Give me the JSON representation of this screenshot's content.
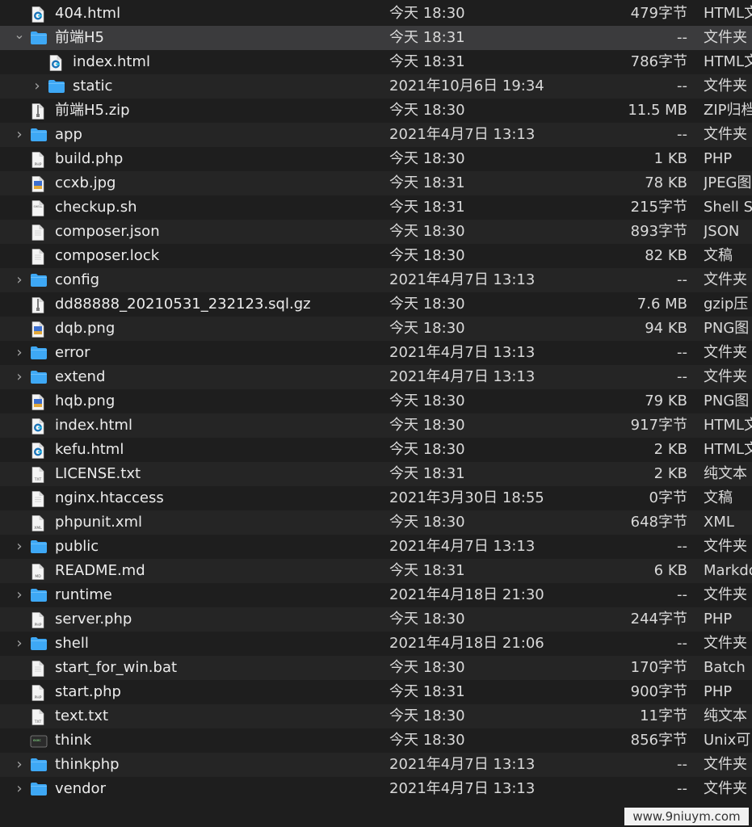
{
  "files": [
    {
      "name": "404.html",
      "date": "今天 18:30",
      "size": "479字节",
      "kind": "HTML文",
      "icon": "html-file-icon",
      "level": 0,
      "folder": false
    },
    {
      "name": "前端H5",
      "date": "今天 18:31",
      "size": "--",
      "kind": "文件夹",
      "icon": "folder-icon",
      "level": 0,
      "folder": true,
      "expanded": true,
      "selected": true
    },
    {
      "name": "index.html",
      "date": "今天 18:31",
      "size": "786字节",
      "kind": "HTML文",
      "icon": "html-file-icon",
      "level": 1,
      "folder": false
    },
    {
      "name": "static",
      "date": "2021年10月6日 19:34",
      "size": "--",
      "kind": "文件夹",
      "icon": "folder-icon",
      "level": 1,
      "folder": true
    },
    {
      "name": "前端H5.zip",
      "date": "今天 18:30",
      "size": "11.5 MB",
      "kind": "ZIP归档",
      "icon": "zip-file-icon",
      "level": 0,
      "folder": false
    },
    {
      "name": "app",
      "date": "2021年4月7日 13:13",
      "size": "--",
      "kind": "文件夹",
      "icon": "folder-icon",
      "level": 0,
      "folder": true
    },
    {
      "name": "build.php",
      "date": "今天 18:30",
      "size": "1 KB",
      "kind": "PHP",
      "icon": "php-file-icon",
      "level": 0,
      "folder": false
    },
    {
      "name": "ccxb.jpg",
      "date": "今天 18:31",
      "size": "78 KB",
      "kind": "JPEG图",
      "icon": "image-file-icon",
      "level": 0,
      "folder": false
    },
    {
      "name": "checkup.sh",
      "date": "今天 18:31",
      "size": "215字节",
      "kind": "Shell S",
      "icon": "shell-file-icon",
      "level": 0,
      "folder": false
    },
    {
      "name": "composer.json",
      "date": "今天 18:30",
      "size": "893字节",
      "kind": "JSON",
      "icon": "document-icon",
      "level": 0,
      "folder": false
    },
    {
      "name": "composer.lock",
      "date": "今天 18:30",
      "size": "82 KB",
      "kind": "文稿",
      "icon": "document-icon",
      "level": 0,
      "folder": false
    },
    {
      "name": "config",
      "date": "2021年4月7日 13:13",
      "size": "--",
      "kind": "文件夹",
      "icon": "folder-icon",
      "level": 0,
      "folder": true
    },
    {
      "name": "dd88888_20210531_232123.sql.gz",
      "date": "今天 18:30",
      "size": "7.6 MB",
      "kind": "gzip压",
      "icon": "zip-file-icon",
      "level": 0,
      "folder": false
    },
    {
      "name": "dqb.png",
      "date": "今天 18:30",
      "size": "94 KB",
      "kind": "PNG图",
      "icon": "image-file-icon",
      "level": 0,
      "folder": false
    },
    {
      "name": "error",
      "date": "2021年4月7日 13:13",
      "size": "--",
      "kind": "文件夹",
      "icon": "folder-icon",
      "level": 0,
      "folder": true
    },
    {
      "name": "extend",
      "date": "2021年4月7日 13:13",
      "size": "--",
      "kind": "文件夹",
      "icon": "folder-icon",
      "level": 0,
      "folder": true
    },
    {
      "name": "hqb.png",
      "date": "今天 18:30",
      "size": "79 KB",
      "kind": "PNG图",
      "icon": "image-file-icon",
      "level": 0,
      "folder": false
    },
    {
      "name": "index.html",
      "date": "今天 18:30",
      "size": "917字节",
      "kind": "HTML文",
      "icon": "html-file-icon",
      "level": 0,
      "folder": false
    },
    {
      "name": "kefu.html",
      "date": "今天 18:30",
      "size": "2 KB",
      "kind": "HTML文",
      "icon": "html-file-icon",
      "level": 0,
      "folder": false
    },
    {
      "name": "LICENSE.txt",
      "date": "今天 18:31",
      "size": "2 KB",
      "kind": "纯文本",
      "icon": "text-file-icon",
      "level": 0,
      "folder": false
    },
    {
      "name": "nginx.htaccess",
      "date": "2021年3月30日 18:55",
      "size": "0字节",
      "kind": "文稿",
      "icon": "document-icon",
      "level": 0,
      "folder": false
    },
    {
      "name": "phpunit.xml",
      "date": "今天 18:30",
      "size": "648字节",
      "kind": "XML",
      "icon": "xml-file-icon",
      "level": 0,
      "folder": false
    },
    {
      "name": "public",
      "date": "2021年4月7日 13:13",
      "size": "--",
      "kind": "文件夹",
      "icon": "folder-icon",
      "level": 0,
      "folder": true
    },
    {
      "name": "README.md",
      "date": "今天 18:31",
      "size": "6 KB",
      "kind": "Markdo",
      "icon": "markdown-file-icon",
      "level": 0,
      "folder": false
    },
    {
      "name": "runtime",
      "date": "2021年4月18日 21:30",
      "size": "--",
      "kind": "文件夹",
      "icon": "folder-icon",
      "level": 0,
      "folder": true
    },
    {
      "name": "server.php",
      "date": "今天 18:30",
      "size": "244字节",
      "kind": "PHP",
      "icon": "php-file-icon",
      "level": 0,
      "folder": false
    },
    {
      "name": "shell",
      "date": "2021年4月18日 21:06",
      "size": "--",
      "kind": "文件夹",
      "icon": "folder-icon",
      "level": 0,
      "folder": true
    },
    {
      "name": "start_for_win.bat",
      "date": "今天 18:30",
      "size": "170字节",
      "kind": "Batch",
      "icon": "document-icon",
      "level": 0,
      "folder": false
    },
    {
      "name": "start.php",
      "date": "今天 18:31",
      "size": "900字节",
      "kind": "PHP",
      "icon": "php-file-icon",
      "level": 0,
      "folder": false
    },
    {
      "name": "text.txt",
      "date": "今天 18:30",
      "size": "11字节",
      "kind": "纯文本",
      "icon": "text-file-icon",
      "level": 0,
      "folder": false
    },
    {
      "name": "think",
      "date": "今天 18:30",
      "size": "856字节",
      "kind": "Unix可",
      "icon": "terminal-file-icon",
      "level": 0,
      "folder": false
    },
    {
      "name": "thinkphp",
      "date": "2021年4月7日 13:13",
      "size": "--",
      "kind": "文件夹",
      "icon": "folder-icon",
      "level": 0,
      "folder": true
    },
    {
      "name": "vendor",
      "date": "2021年4月7日 13:13",
      "size": "--",
      "kind": "文件夹",
      "icon": "folder-icon",
      "level": 0,
      "folder": true
    }
  ],
  "watermark": "www.9niuym.com",
  "colors": {
    "folder": "#3ea8f5",
    "folder_tab": "#6cc0fb",
    "selection": "#3b3b3d",
    "background": "#1e1e1e",
    "alt_row": "#252525"
  }
}
